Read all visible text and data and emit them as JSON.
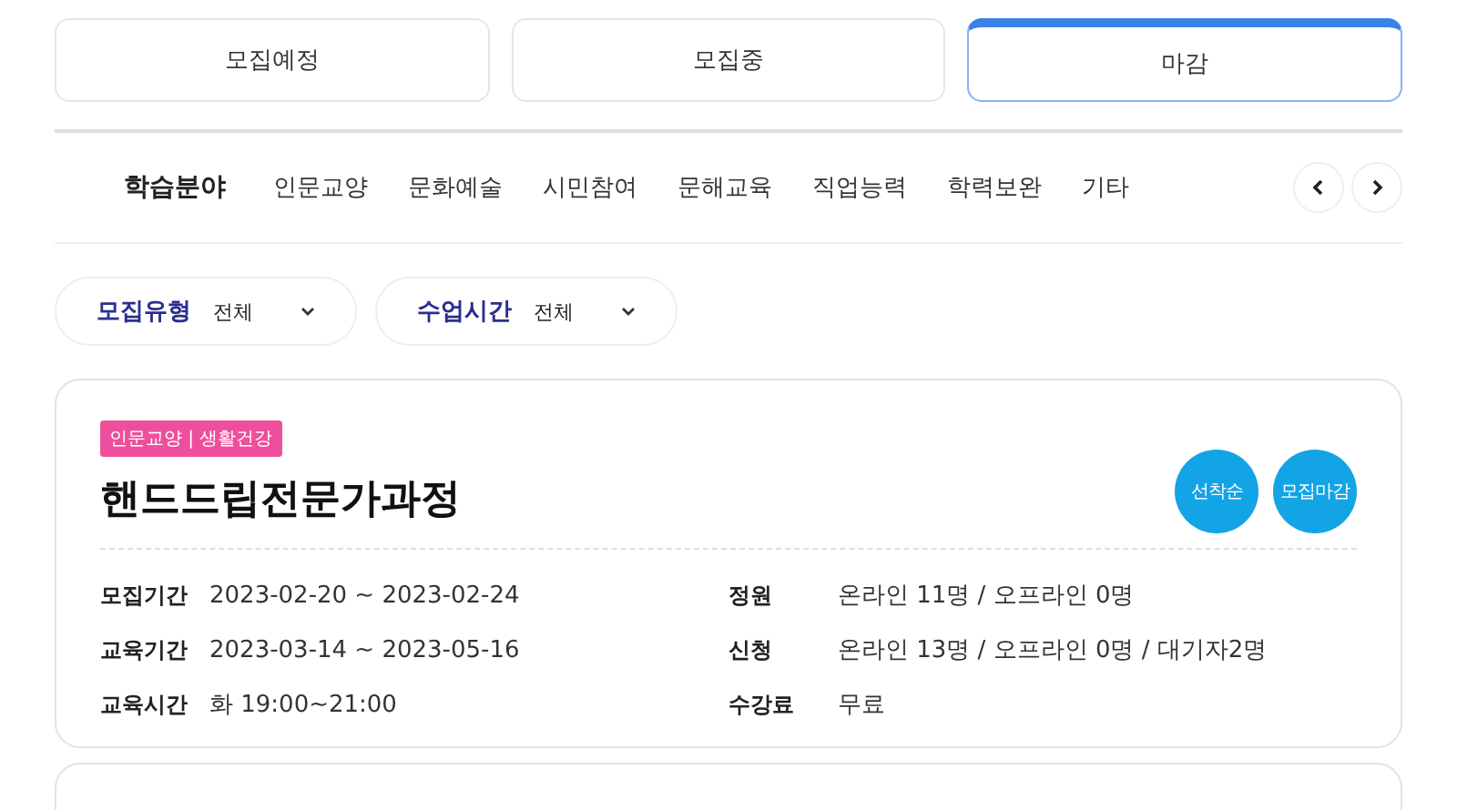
{
  "status_tabs": [
    {
      "label": "모집예정",
      "selected": false
    },
    {
      "label": "모집중",
      "selected": false
    },
    {
      "label": "마감",
      "selected": true
    }
  ],
  "category_bar": {
    "label": "학습분야",
    "items": [
      "인문교양",
      "문화예술",
      "시민참여",
      "문해교육",
      "직업능력",
      "학력보완",
      "기타"
    ]
  },
  "filters": [
    {
      "label": "모집유형",
      "value": "전체"
    },
    {
      "label": "수업시간",
      "value": "전체"
    }
  ],
  "courses": [
    {
      "tag": "인문교양 | 생활건강",
      "title": "핸드드립전문가과정",
      "badges": [
        "선착순",
        "모집마감"
      ],
      "details": [
        {
          "label": "모집기간",
          "value": "2023-02-20 ~ 2023-02-24"
        },
        {
          "label": "정원",
          "value": "온라인 11명 / 오프라인 0명"
        },
        {
          "label": "교육기간",
          "value": "2023-03-14 ~ 2023-05-16"
        },
        {
          "label": "신청",
          "value": "온라인 13명 / 오프라인 0명 / 대기자2명"
        },
        {
          "label": "교육시간",
          "value": "화 19:00~21:00"
        },
        {
          "label": "수강료",
          "value": "무료"
        }
      ]
    }
  ]
}
